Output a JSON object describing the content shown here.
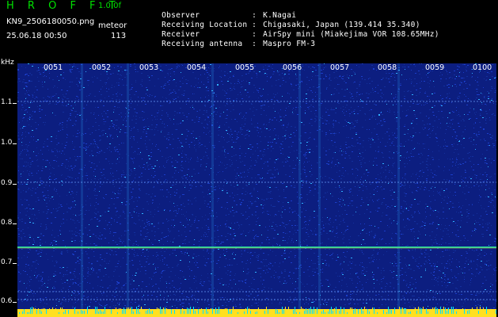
{
  "header": {
    "app_title": "H R O F F T",
    "version": "1.0.0f",
    "filename": "KN9_2506180050.png",
    "mode": "meteor",
    "datetime": "25.06.18 00:50",
    "count": "113"
  },
  "station_info": [
    {
      "label": "Observer",
      "value": "K.Nagai"
    },
    {
      "label": "Receiving Location",
      "value": "Chigasaki, Japan (139.414 35.340)"
    },
    {
      "label": "Receiver",
      "value": "AirSpy mini (Miakejima VOR 108.65MHz)"
    },
    {
      "label": "Receiving antenna",
      "value": "Maspro FM-3"
    }
  ],
  "spectrogram": {
    "y_unit": "kHz",
    "y_ticks": [
      "1.1",
      "1.0",
      "0.9",
      "0.8",
      "0.7",
      "0.6"
    ],
    "x_ticks": [
      "0051",
      "0052",
      "0053",
      "0054",
      "0055",
      "0056",
      "0057",
      "0058",
      "0059",
      "0100"
    ],
    "colors": {
      "background": "#0c1e80",
      "noise_low": "#1b3dc8",
      "noise_high": "#30b0ff",
      "carrier": "#28d8a0",
      "baseline": "#ffe020"
    }
  }
}
